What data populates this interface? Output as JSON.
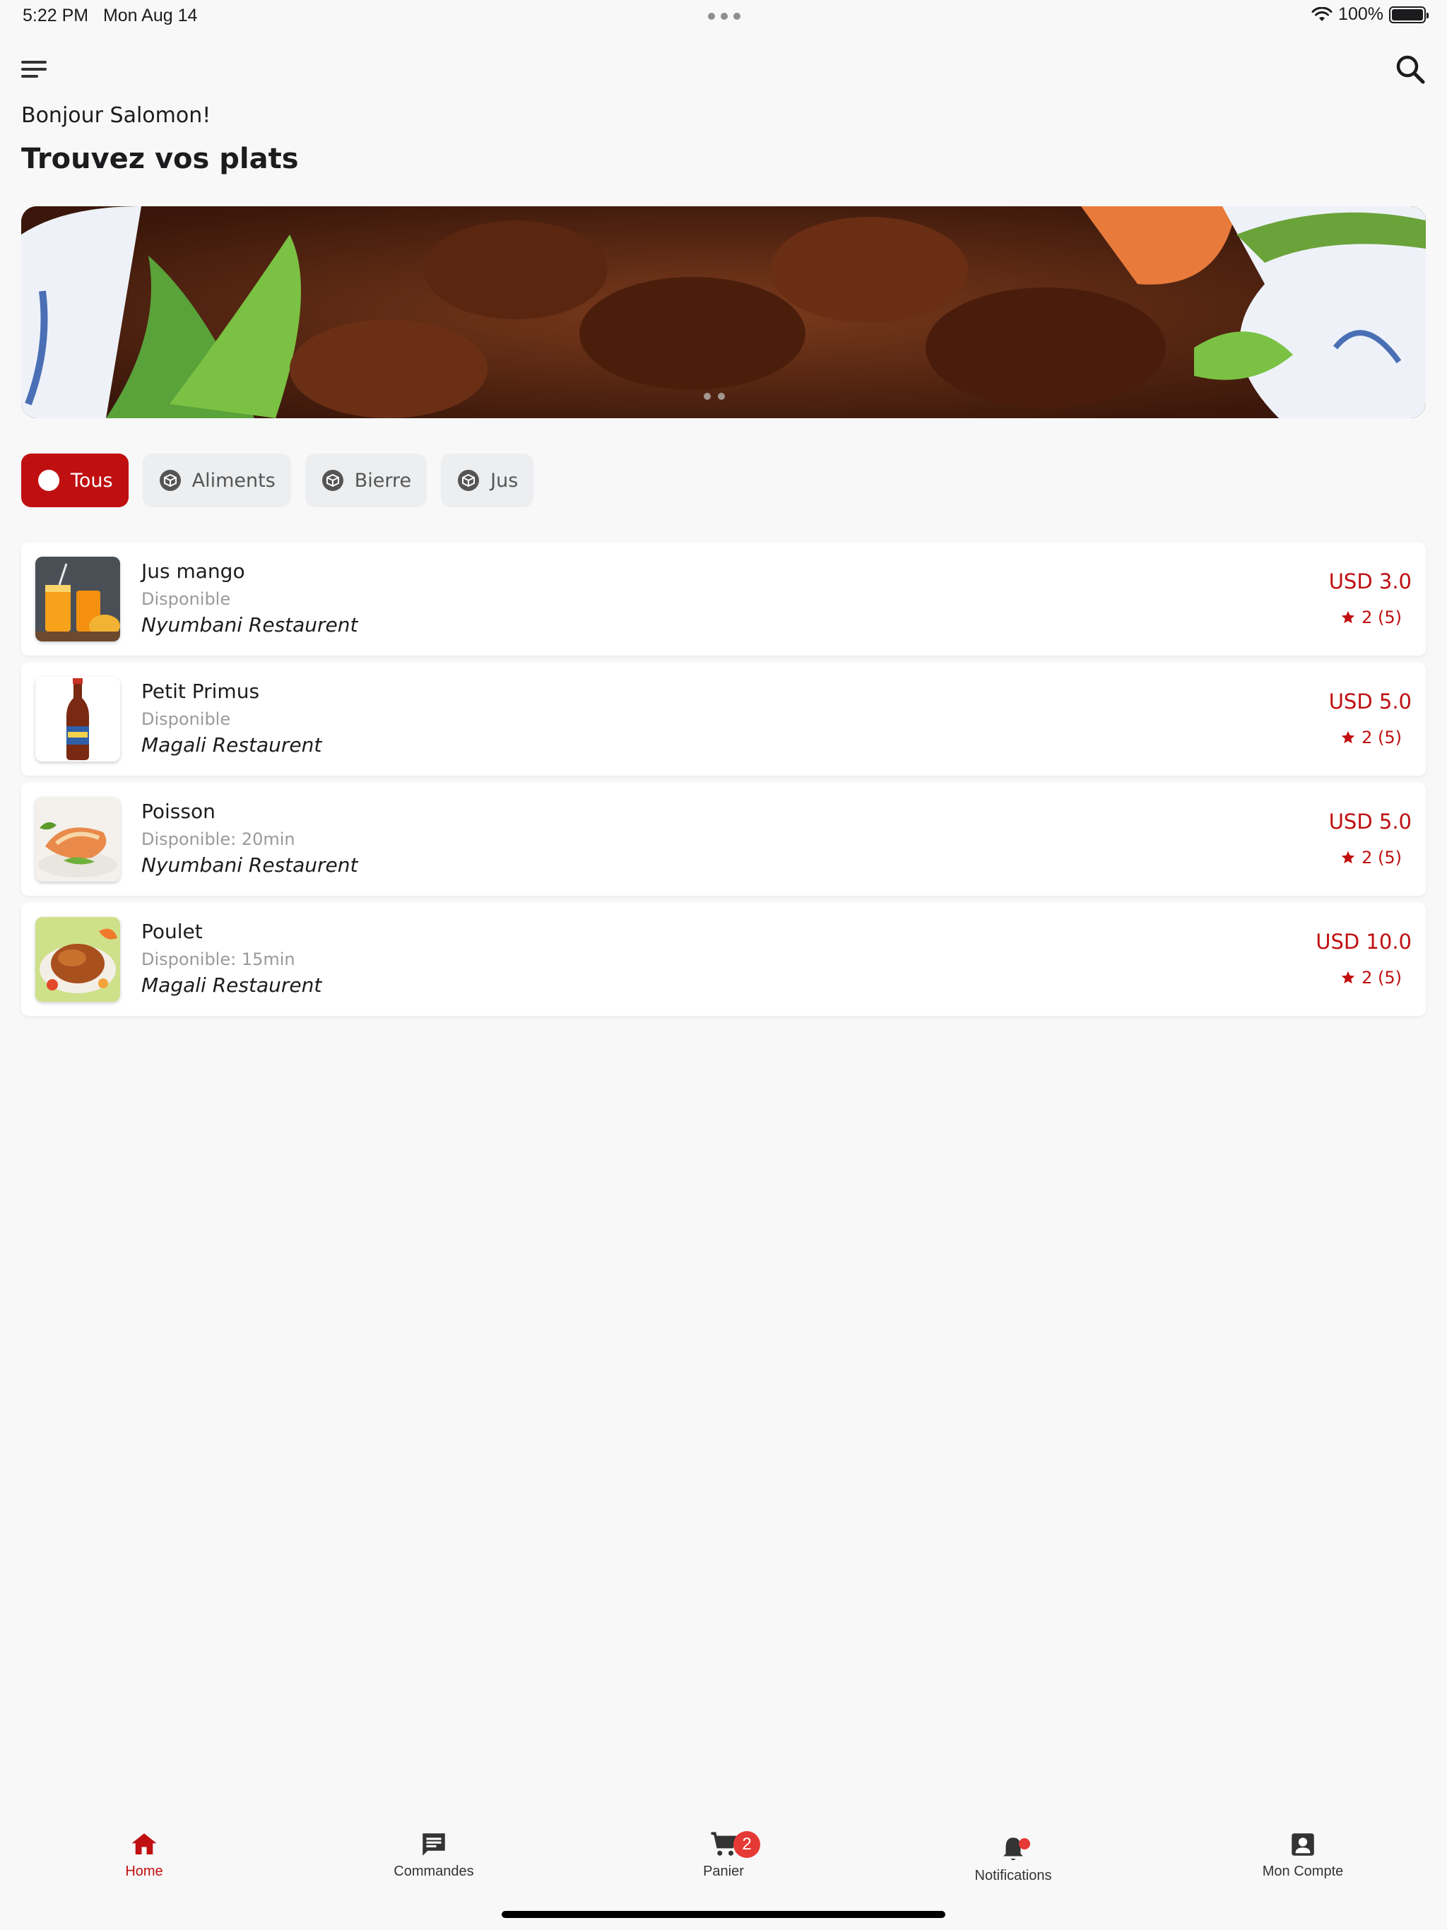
{
  "status_bar": {
    "time": "5:22 PM",
    "date": "Mon Aug 14",
    "battery": "100%",
    "battery_level": 1.0
  },
  "header": {
    "greeting": "Bonjour Salomon!",
    "title": "Trouvez vos plats"
  },
  "categories": [
    {
      "label": "Tous",
      "active": true
    },
    {
      "label": "Aliments",
      "active": false
    },
    {
      "label": "Bierre",
      "active": false
    },
    {
      "label": "Jus",
      "active": false
    }
  ],
  "products": [
    {
      "name": "Jus mango",
      "availability": "Disponible",
      "restaurant": "Nyumbani Restaurent",
      "price": "USD 3.0",
      "rating": "2 (5)",
      "image": "mango-juice-photo"
    },
    {
      "name": "Petit Primus",
      "availability": "Disponible",
      "restaurant": "Magali Restaurent",
      "price": "USD 5.0",
      "rating": "2 (5)",
      "image": "beer-bottle-photo"
    },
    {
      "name": "Poisson",
      "availability": "Disponible: 20min",
      "restaurant": "Nyumbani Restaurent",
      "price": "USD 5.0",
      "rating": "2 (5)",
      "image": "fish-dish-photo"
    },
    {
      "name": "Poulet",
      "availability": "Disponible: 15min",
      "restaurant": "Magali Restaurent",
      "price": "USD 10.0",
      "rating": "2 (5)",
      "image": "roast-chicken-photo"
    }
  ],
  "bottom_nav": [
    {
      "label": "Home",
      "icon": "home-icon",
      "active": true
    },
    {
      "label": "Commandes",
      "icon": "chat-icon",
      "active": false
    },
    {
      "label": "Panier",
      "icon": "cart-icon",
      "active": false,
      "badge": "2"
    },
    {
      "label": "Notifications",
      "icon": "bell-icon",
      "active": false
    },
    {
      "label": "Mon Compte",
      "icon": "account-icon",
      "active": false
    }
  ],
  "colors": {
    "accent": "#c00f10",
    "background": "#f8f8f9",
    "chip_inactive": "#eceef0",
    "muted_text": "#9a9a9e"
  }
}
